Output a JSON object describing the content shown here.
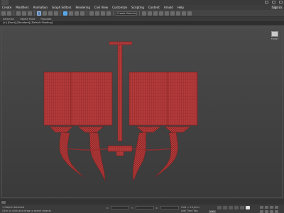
{
  "app": {
    "sign_in": "Sign in"
  },
  "menu": [
    "Create",
    "Modifiers",
    "Animation",
    "Graph Editors",
    "Rendering",
    "Civil View",
    "Customize",
    "Scripting",
    "Content",
    "Arnold",
    "Help"
  ],
  "toolbar": {
    "selection_set": "Create Selection Set"
  },
  "ribbon": [
    "Selection",
    "Object Paint",
    "Populate"
  ],
  "viewport": {
    "label": "[+] [Front] [Standard] [Default Shading]",
    "viewcube_label": "FRONT",
    "model_color": "#b23a3a",
    "wire_color": "#7a1e1e",
    "bg_top": "#4a4a4a",
    "bg_bottom": "#3a3a3a"
  },
  "status": {
    "line1": "1 Object Selected",
    "line2": "Click or click-and-drag to select objects",
    "x_label": "X:",
    "y_label": "Y:",
    "z_label": "Z:",
    "grid": "Grid = 10,0cm",
    "add_time_tag": "Add Time Tag",
    "auto_key": "Auto"
  }
}
